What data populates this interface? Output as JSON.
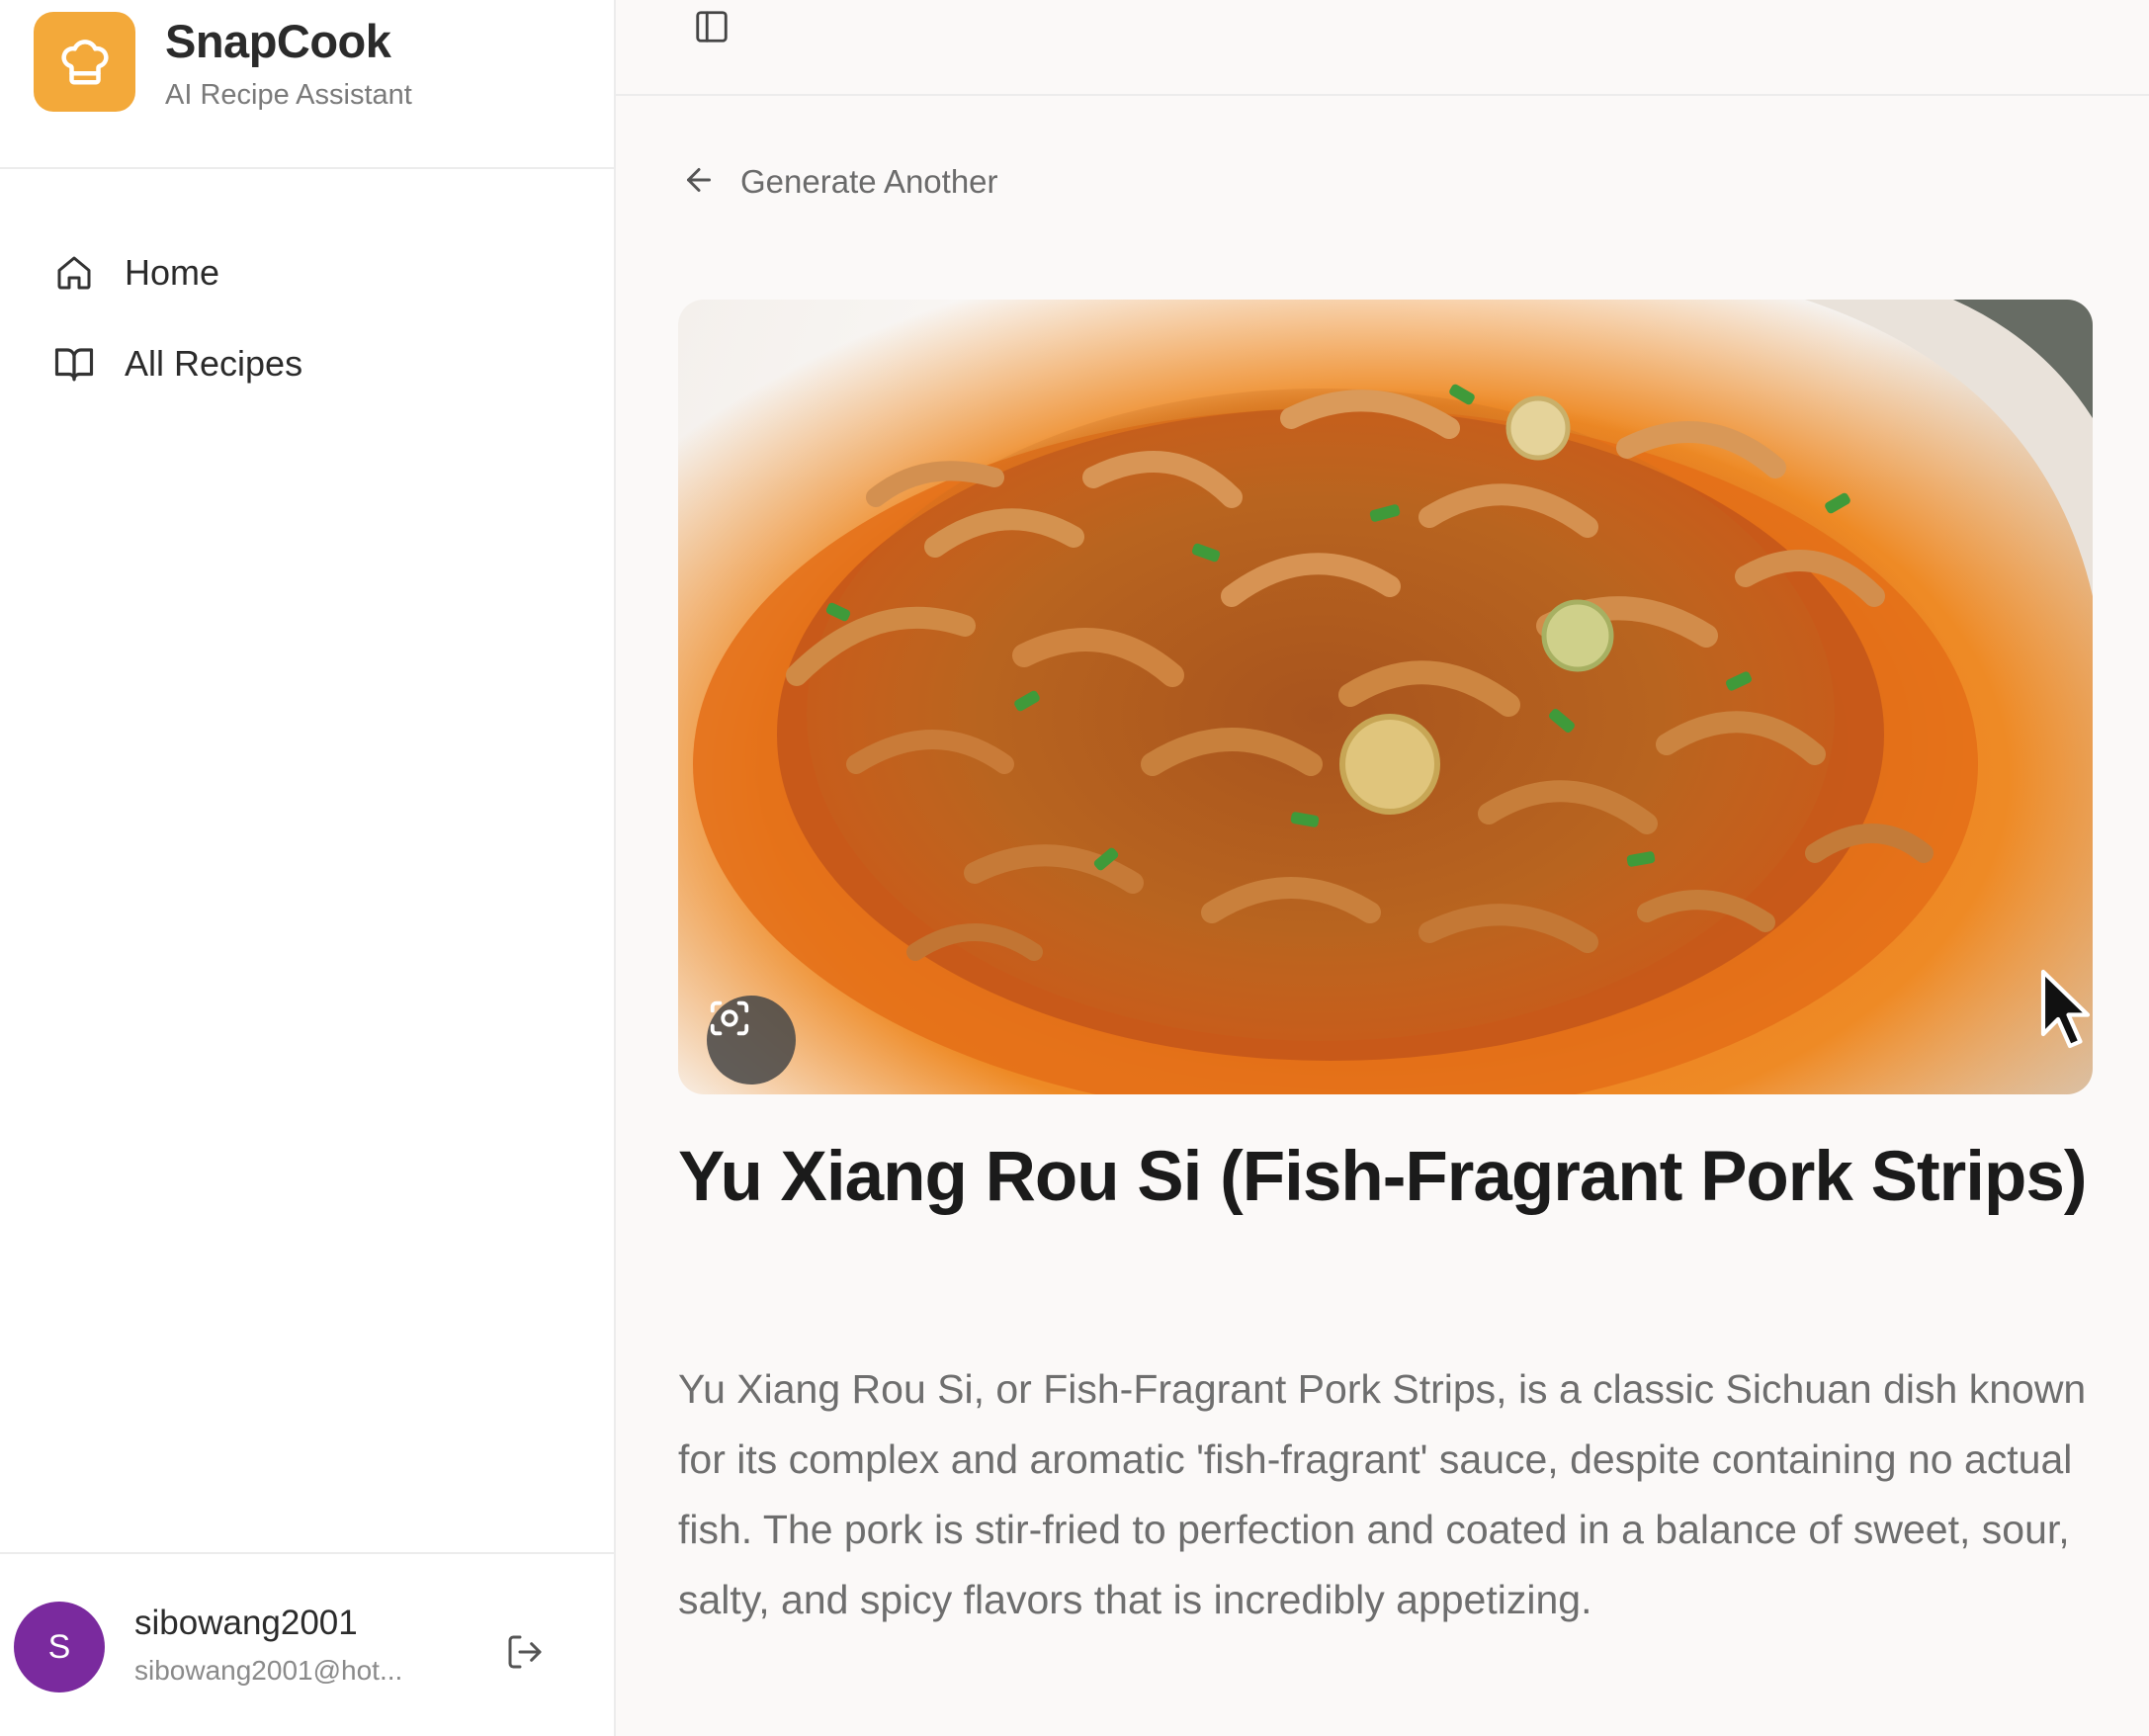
{
  "app": {
    "name": "SnapCook",
    "tagline": "AI Recipe Assistant",
    "brand_color": "#f3a93a",
    "logo_icon": "chef-hat-icon"
  },
  "sidebar": {
    "items": [
      {
        "label": "Home",
        "icon": "home-icon"
      },
      {
        "label": "All Recipes",
        "icon": "book-icon"
      }
    ]
  },
  "user": {
    "initial": "S",
    "name": "sibowang2001",
    "email": "sibowang2001@hot...",
    "avatar_color": "#7a2a9e",
    "logout_icon": "logout-icon"
  },
  "toolbar": {
    "toggle_icon": "sidebar-toggle-icon"
  },
  "main": {
    "back_label": "Generate Another",
    "back_icon": "arrow-left-icon",
    "image_alt": "Yu Xiang Rou Si dish photo",
    "camera_icon": "camera-switch-icon",
    "title": "Yu Xiang Rou Si (Fish-Fragrant Pork Strips)",
    "description": "Yu Xiang Rou Si, or Fish-Fragrant Pork Strips, is a classic Sichuan dish known for its complex and aromatic 'fish-fragrant' sauce, despite containing no actual fish. The pork is stir-fried to perfection and coated in a balance of sweet, sour, salty, and spicy flavors that is incredibly appetizing."
  }
}
